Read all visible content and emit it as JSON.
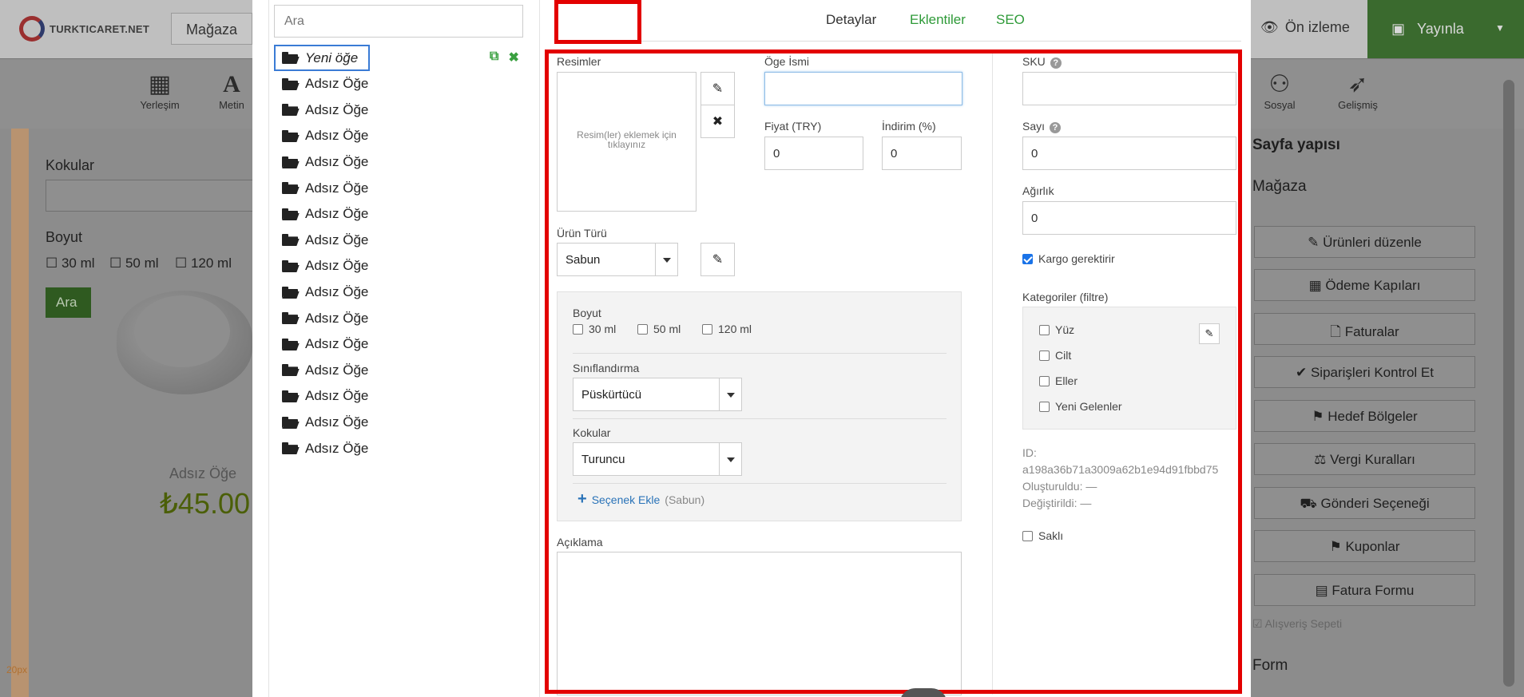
{
  "app": {
    "logo": "TURKTICARET.NET",
    "store_button": "Mağaza",
    "preview": "Ön izleme",
    "publish": "Yayınla"
  },
  "toolbar": {
    "layout": "Yerleşim",
    "text": "Metin",
    "social": "Sosyal",
    "advanced": "Gelişmiş"
  },
  "canvas": {
    "scents_label": "Kokular",
    "size_label": "Boyut",
    "sizes": [
      "30 ml",
      "50 ml",
      "120 ml"
    ],
    "search_button": "Ara",
    "product_title": "Adsız Öğe",
    "product_price": "₺45.00",
    "ruler_label": "20px"
  },
  "right_panel": {
    "page_structure": "Sayfa yapısı",
    "store": "Mağaza",
    "buttons": [
      "Ürünleri düzenle",
      "Ödeme Kapıları",
      "Faturalar",
      "Siparişleri Kontrol Et",
      "Hedef Bölgeler",
      "Vergi Kuralları",
      "Gönderi Seçeneği",
      "Kuponlar",
      "Fatura Formu"
    ],
    "cart_checkbox": "Alışveriş Sepeti",
    "form": "Form"
  },
  "modal": {
    "search_placeholder": "Ara",
    "selected_item": "Yeni öğe",
    "items": [
      "Adsız Öğe",
      "Adsız Öğe",
      "Adsız Öğe",
      "Adsız Öğe",
      "Adsız Öğe",
      "Adsız Öğe",
      "Adsız Öğe",
      "Adsız Öğe",
      "Adsız Öğe",
      "Adsız Öğe",
      "Adsız Öğe",
      "Adsız Öğe",
      "Adsız Öğe",
      "Adsız Öğe",
      "Adsız Öğe"
    ],
    "tabs": [
      "Detaylar",
      "Eklentiler",
      "SEO"
    ],
    "images_label": "Resimler",
    "images_hint": "Resim(ler) eklemek için tıklayınız",
    "item_name_label": "Öge İsmi",
    "item_name_value": "",
    "price_label": "Fiyat (TRY)",
    "price_value": "0",
    "discount_label": "İndirim (%)",
    "discount_value": "0",
    "product_type_label": "Ürün Türü",
    "product_type_value": "Sabun",
    "size_label": "Boyut",
    "sizes": [
      "30 ml",
      "50 ml",
      "120 ml"
    ],
    "classification_label": "Sınıflandırma",
    "classification_value": "Püskürtücü",
    "scents_label": "Kokular",
    "scents_value": "Turuncu",
    "add_option": "Seçenek Ekle",
    "add_option_suffix": "(Sabun)",
    "description_label": "Açıklama",
    "sku_label": "SKU",
    "sku_value": "",
    "quantity_label": "Sayı",
    "quantity_value": "0",
    "weight_label": "Ağırlık",
    "weight_value": "0",
    "shipping_label": "Kargo gerektirir",
    "categories_label": "Kategoriler (filtre)",
    "categories": [
      "Yüz",
      "Cilt",
      "Eller",
      "Yeni Gelenler"
    ],
    "id_label": "ID:",
    "id_value": "a198a36b71a3009a62b1e94d91fbbd75",
    "created": "Oluşturuldu: —",
    "modified": "Değiştirildi: —",
    "hidden_label": "Saklı"
  },
  "colors": {
    "accent_green": "#2e9a38",
    "highlight_red": "#e30000",
    "link_blue": "#2a73b8"
  }
}
